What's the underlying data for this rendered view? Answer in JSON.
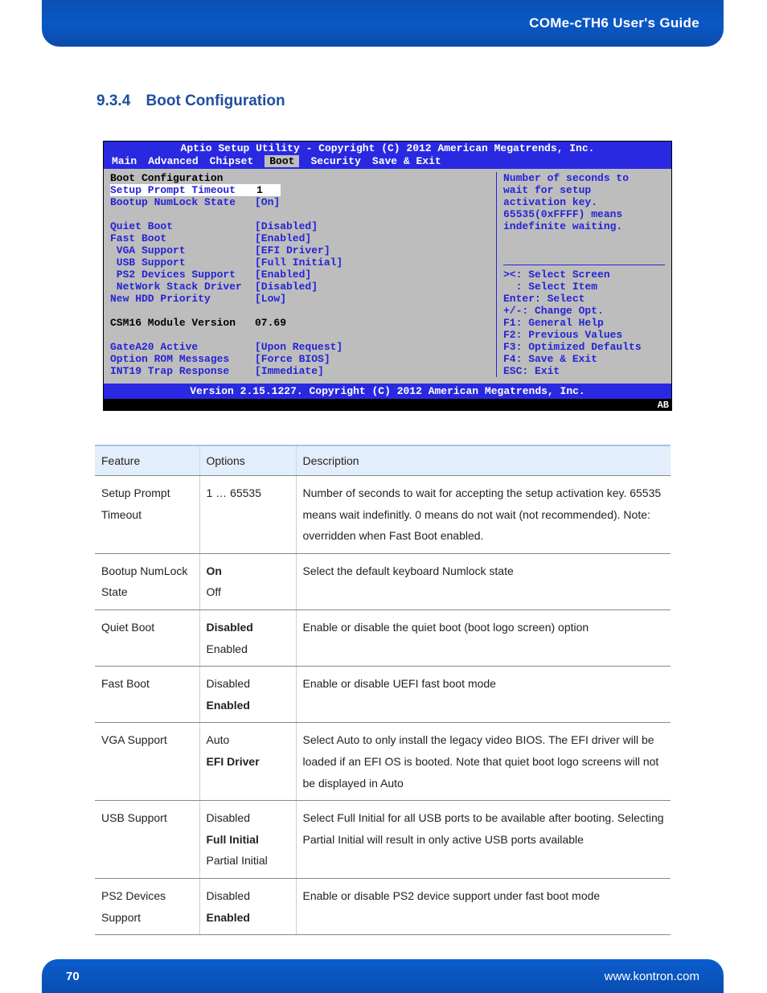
{
  "header": {
    "doc_title": "COMe-cTH6 User's Guide"
  },
  "section": {
    "number": "9.3.4",
    "title": "Boot Configuration"
  },
  "bios": {
    "title": "Aptio Setup Utility - Copyright (C) 2012 American Megatrends, Inc.",
    "menu": [
      "Main",
      "Advanced",
      "Chipset",
      "Boot",
      "Security",
      "Save & Exit"
    ],
    "menu_active": "Boot",
    "heading": "Boot Configuration",
    "rows_group1": [
      {
        "label": "Setup Prompt Timeout",
        "value": "1",
        "highlighted": true
      },
      {
        "label": "Bootup NumLock State",
        "value": "[On]"
      }
    ],
    "rows_group2": [
      {
        "label": "Quiet Boot",
        "value": "[Disabled]"
      },
      {
        "label": "Fast Boot",
        "value": "[Enabled]"
      },
      {
        "label": " VGA Support",
        "value": "[EFI Driver]"
      },
      {
        "label": " USB Support",
        "value": "[Full Initial]"
      },
      {
        "label": " PS2 Devices Support",
        "value": "[Enabled]"
      },
      {
        "label": " NetWork Stack Driver",
        "value": "[Disabled]"
      },
      {
        "label": "New HDD Priority",
        "value": "[Low]"
      }
    ],
    "csm_label": "CSM16 Module Version",
    "csm_value": "07.69",
    "rows_group3": [
      {
        "label": "GateA20 Active",
        "value": "[Upon Request]"
      },
      {
        "label": "Option ROM Messages",
        "value": "[Force BIOS]"
      },
      {
        "label": "INT19 Trap Response",
        "value": "[Immediate]"
      }
    ],
    "help_text": "Number of seconds to\nwait for setup\nactivation key.\n65535(0xFFFF) means\nindefinite waiting.",
    "nav_help": [
      "><: Select Screen",
      "  : Select Item",
      "Enter: Select",
      "+/-: Change Opt.",
      "F1: General Help",
      "F2: Previous Values",
      "F3: Optimized Defaults",
      "F4: Save & Exit",
      "ESC: Exit"
    ],
    "footer": "Version 2.15.1227. Copyright (C) 2012 American Megatrends, Inc.",
    "watermark": "AB"
  },
  "table": {
    "headers": [
      "Feature",
      "Options",
      "Description"
    ],
    "rows": [
      {
        "feature": "Setup Prompt Timeout",
        "options": [
          {
            "t": "1 … 65535",
            "b": false
          }
        ],
        "desc": "Number of seconds to wait for accepting the setup activation key. 65535 means wait indefinitly.  0 means do not wait (not recommended).  Note: overridden when Fast Boot enabled."
      },
      {
        "feature": "Bootup NumLock State",
        "options": [
          {
            "t": "On",
            "b": true
          },
          {
            "t": "Off",
            "b": false
          }
        ],
        "desc": "Select the default keyboard Numlock state"
      },
      {
        "feature": "Quiet Boot",
        "options": [
          {
            "t": "Disabled",
            "b": true
          },
          {
            "t": "Enabled",
            "b": false
          }
        ],
        "desc": "Enable or disable the quiet boot (boot logo screen) option"
      },
      {
        "feature": "Fast Boot",
        "options": [
          {
            "t": "Disabled",
            "b": false
          },
          {
            "t": "Enabled",
            "b": true
          }
        ],
        "desc": "Enable or disable UEFI fast boot mode"
      },
      {
        "feature": "VGA Support",
        "options": [
          {
            "t": "Auto",
            "b": false
          },
          {
            "t": "EFI Driver",
            "b": true
          }
        ],
        "desc": "Select Auto to only install the legacy video BIOS.  The EFI driver will be loaded if an EFI OS is booted.  Note that quiet boot logo screens will not be displayed in Auto"
      },
      {
        "feature": "USB Support",
        "options": [
          {
            "t": "Disabled",
            "b": false
          },
          {
            "t": "Full Initial",
            "b": true
          },
          {
            "t": "Partial Initial",
            "b": false
          }
        ],
        "desc": "Select Full Initial for all USB ports to be available after booting. Selecting Partial Initial will result in only active USB ports available"
      },
      {
        "feature": "PS2 Devices Support",
        "options": [
          {
            "t": "Disabled",
            "b": false
          },
          {
            "t": "Enabled",
            "b": true
          }
        ],
        "desc": "Enable or disable PS2 device support under fast boot mode"
      }
    ]
  },
  "footer": {
    "page": "70",
    "url": "www.kontron.com"
  }
}
